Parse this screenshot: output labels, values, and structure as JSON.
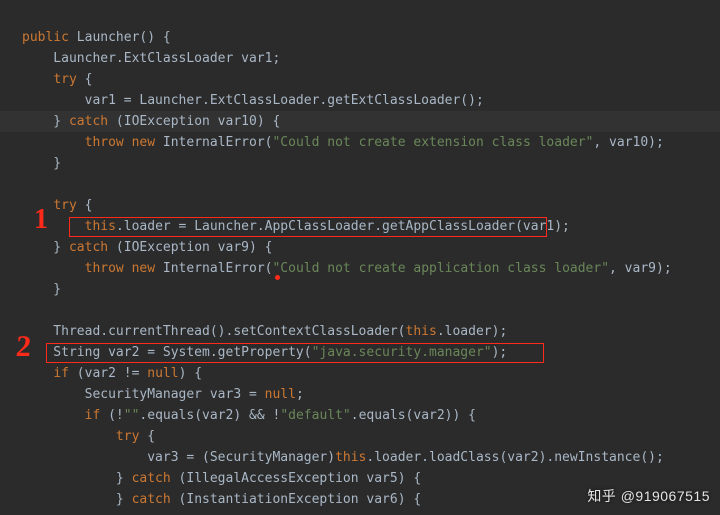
{
  "watermark": "知乎 @919067515",
  "annotation1": "1",
  "annotation2": "2",
  "code": {
    "l1": {
      "a": "public",
      "b": " Launcher() {"
    },
    "l2": {
      "a": "    Launcher.ExtClassLoader var1;"
    },
    "l3": {
      "a": "    ",
      "b": "try",
      "c": " {"
    },
    "l4": {
      "a": "        var1 = Launcher.ExtClassLoader.getExtClassLoader();"
    },
    "l5": {
      "a": "    } ",
      "b": "catch",
      "c": " (IOException var10) {"
    },
    "l6": {
      "a": "        ",
      "b": "throw new",
      "c": " InternalError(",
      "d": "\"Could not create extension class loader\"",
      "e": ", var10);"
    },
    "l7": {
      "a": "    }"
    },
    "l8": {
      "a": ""
    },
    "l9": {
      "a": "    ",
      "b": "try",
      "c": " {"
    },
    "l10": {
      "a": "        ",
      "b": "this",
      "c": ".loader = Launcher.AppClassLoader.getAppClassLoader(var1);"
    },
    "l11": {
      "a": "    } ",
      "b": "catch",
      "c": " (IOException var9) {"
    },
    "l12": {
      "a": "        ",
      "b": "throw new",
      "c": " InternalError(",
      "d": "\"Could not create application class loader\"",
      "e": ", var9);"
    },
    "l13": {
      "a": "    }"
    },
    "l14": {
      "a": ""
    },
    "l15": {
      "a": "    Thread.currentThread().setContextClassLoader(",
      "b": "this",
      "c": ".loader);"
    },
    "l16": {
      "a": "    String var2 = System.getProperty(",
      "b": "\"java.security.manager\"",
      "c": ");"
    },
    "l17": {
      "a": "    ",
      "b": "if",
      "c": " (var2 != ",
      "d": "null",
      "e": ") {"
    },
    "l18": {
      "a": "        SecurityManager var3 = ",
      "b": "null",
      "c": ";"
    },
    "l19": {
      "a": "        ",
      "b": "if",
      "c": " (!",
      "d": "\"\"",
      "e": ".equals(var2) && !",
      "f": "\"default\"",
      "g": ".equals(var2)) {"
    },
    "l20": {
      "a": "            ",
      "b": "try",
      "c": " {"
    },
    "l21": {
      "a": "                var3 = (SecurityManager)",
      "b": "this",
      "c": ".loader.loadClass(var2).newInstance();"
    },
    "l22": {
      "a": "            } ",
      "b": "catch",
      "c": " (IllegalAccessException var5) {"
    },
    "l23": {
      "a": "            } ",
      "b": "catch",
      "c": " (InstantiationException var6) {"
    }
  }
}
